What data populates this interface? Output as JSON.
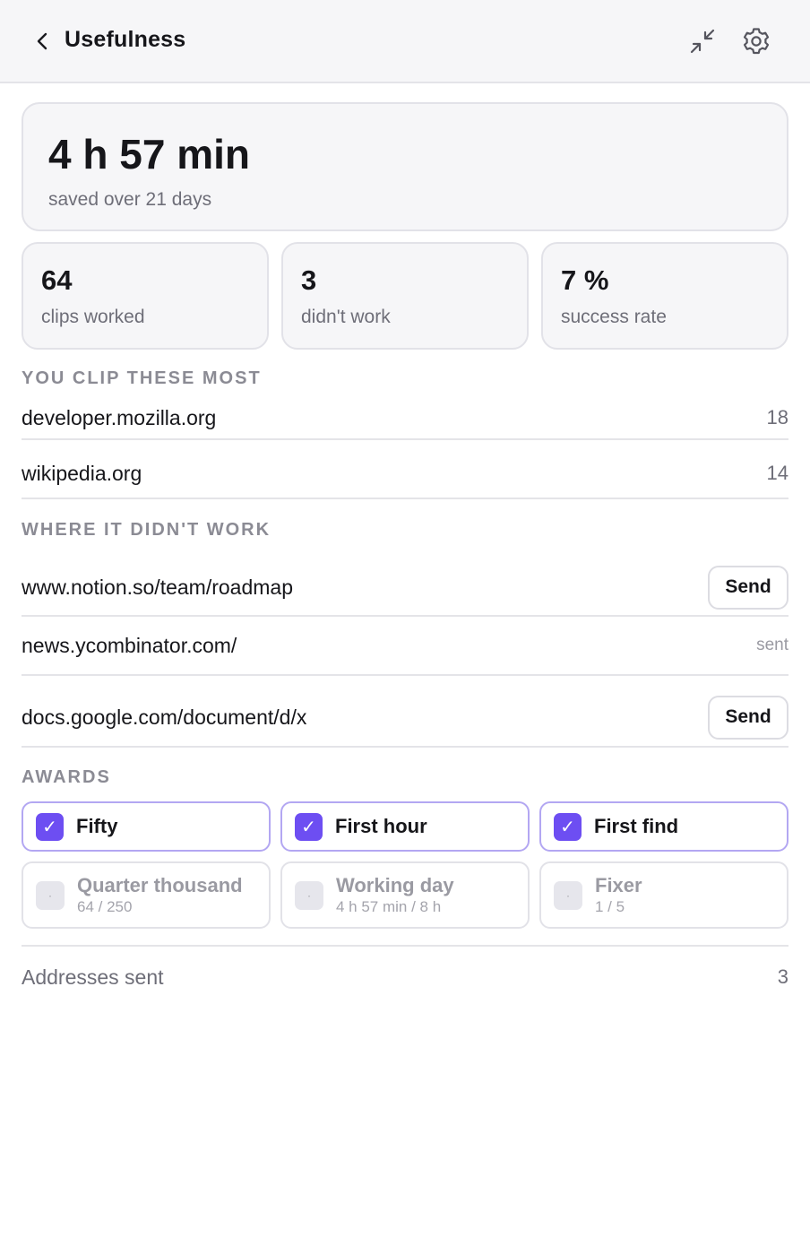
{
  "header": {
    "title": "Usefulness",
    "back_icon": "chevron-left-icon",
    "collapse_icon": "collapse-icon",
    "settings_icon": "gear-icon"
  },
  "summary": {
    "time_saved": "4 h 57 min",
    "subtitle": "saved over 21 days"
  },
  "stats": [
    {
      "value": "64",
      "label": "clips worked"
    },
    {
      "value": "3",
      "label": "didn't work"
    },
    {
      "value": "7 %",
      "label": "success rate"
    }
  ],
  "top_sites": {
    "title": "YOU CLIP THESE MOST",
    "items": [
      {
        "site": "developer.mozilla.org",
        "count": "18"
      },
      {
        "site": "wikipedia.org",
        "count": "14"
      }
    ]
  },
  "failures": {
    "title": "WHERE IT DIDN'T WORK",
    "items": [
      {
        "url": "www.notion.so/team/roadmap",
        "action": "Send"
      },
      {
        "url": "news.ycombinator.com/",
        "status": "sent"
      },
      {
        "url": "docs.google.com/document/d/x",
        "action": "Send"
      }
    ]
  },
  "awards": {
    "title": "AWARDS",
    "earned": [
      {
        "name": "Fifty",
        "check": "✓"
      },
      {
        "name": "First hour",
        "check": "✓"
      },
      {
        "name": "First find",
        "check": "✓"
      }
    ],
    "locked": [
      {
        "name": "Quarter thousand",
        "progress": "64 / 250",
        "mark": "·"
      },
      {
        "name": "Working day",
        "progress": "4 h 57 min / 8 h",
        "mark": "·"
      },
      {
        "name": "Fixer",
        "progress": "1 / 5",
        "mark": "·"
      }
    ]
  },
  "footer": {
    "label": "Addresses sent",
    "count": "3"
  },
  "colors": {
    "accent": "#6d4ef2",
    "accent_border": "#b3a7f2",
    "card_bg": "#f6f6f8",
    "muted_text": "#6e6e78"
  }
}
